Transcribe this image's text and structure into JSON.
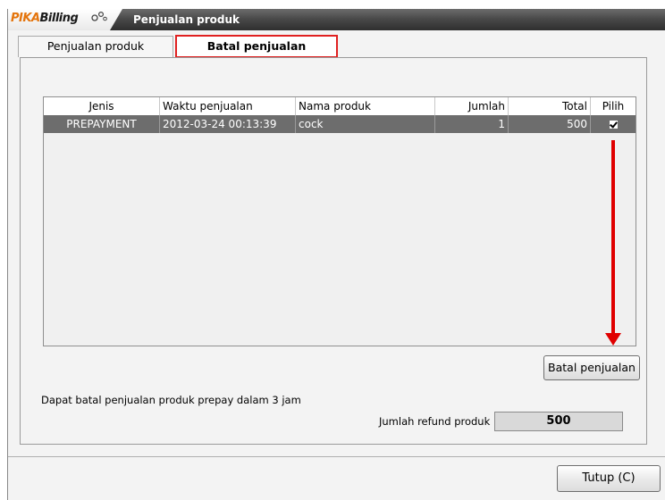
{
  "app": {
    "logo_pika": "PIKA",
    "logo_billing": "Billing",
    "window_title": "Penjualan produk"
  },
  "tabs": [
    {
      "label": "Penjualan produk",
      "active": false
    },
    {
      "label": "Batal penjualan",
      "active": true
    }
  ],
  "table": {
    "columns": [
      "Jenis",
      "Waktu penjualan",
      "Nama produk",
      "Jumlah",
      "Total",
      "Pilih"
    ],
    "rows": [
      {
        "jenis": "PREPAYMENT",
        "waktu": "2012-03-24 00:13:39",
        "nama": "cock",
        "jumlah": "1",
        "total": "500",
        "pilih": true
      }
    ]
  },
  "actions": {
    "batal_button": "Batal penjualan",
    "tutup_button": "Tutup (C)"
  },
  "info_text": "Dapat batal penjualan produk prepay dalam 3 jam",
  "refund": {
    "label": "Jumlah refund produk",
    "value": "500"
  },
  "colors": {
    "accent_red": "#e00000",
    "logo_orange": "#e4740c",
    "selected_row": "#6d6d6d",
    "titlebar": "#3a3a3a"
  }
}
